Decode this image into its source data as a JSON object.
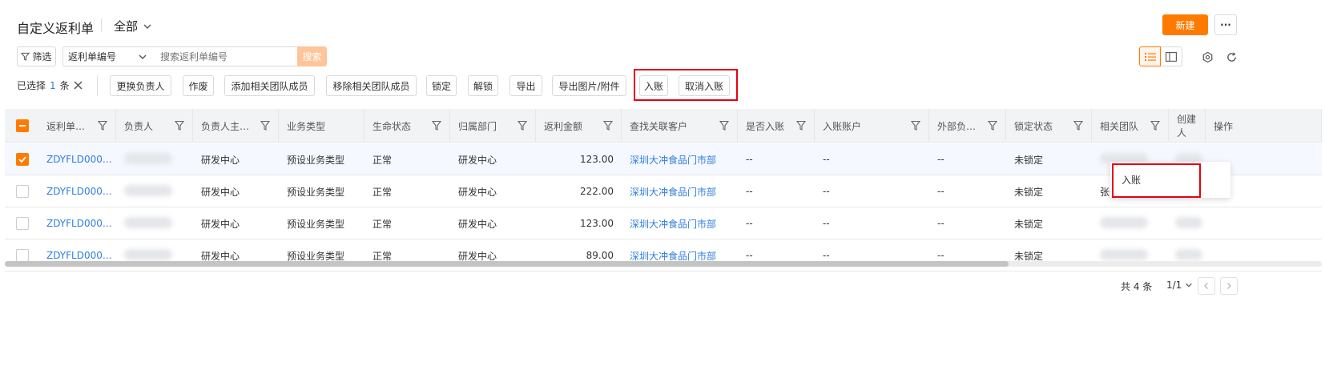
{
  "header": {
    "title": "自定义返利单",
    "view_label": "全部",
    "new_button": "新建",
    "more": "···"
  },
  "filterbar": {
    "filter_label": "筛选",
    "field_select": "返利单编号",
    "search_placeholder": "搜索返利单编号",
    "search_button": "搜索"
  },
  "selection": {
    "prefix": "已选择",
    "count": "1",
    "suffix": "条"
  },
  "actions": [
    "更换负责人",
    "作废",
    "添加相关团队成员",
    "移除相关团队成员",
    "锁定",
    "解锁",
    "导出",
    "导出图片/附件",
    "入账",
    "取消入账"
  ],
  "columns": [
    "返利单…",
    "负责人",
    "负责人主…",
    "业务类型",
    "生命状态",
    "归属部门",
    "返利金额",
    "查找关联客户",
    "是否入账",
    "入账账户",
    "外部负…",
    "锁定状态",
    "相关团队",
    "创建人",
    "操作"
  ],
  "rows": [
    {
      "id": "ZDYFLD000…",
      "owner_dept": "研发中心",
      "biz_type": "预设业务类型",
      "life": "正常",
      "dept": "研发中心",
      "amount": "123.00",
      "customer": "深圳大冲食品门市部",
      "posted": "--",
      "account": "--",
      "ext": "--",
      "lock": "未锁定",
      "team": ""
    },
    {
      "id": "ZDYFLD000…",
      "owner_dept": "研发中心",
      "biz_type": "预设业务类型",
      "life": "正常",
      "dept": "研发中心",
      "amount": "222.00",
      "customer": "深圳大冲食品门市部",
      "posted": "--",
      "account": "--",
      "ext": "--",
      "lock": "未锁定",
      "team": "张"
    },
    {
      "id": "ZDYFLD000…",
      "owner_dept": "研发中心",
      "biz_type": "预设业务类型",
      "life": "正常",
      "dept": "研发中心",
      "amount": "123.00",
      "customer": "深圳大冲食品门市部",
      "posted": "--",
      "account": "--",
      "ext": "--",
      "lock": "未锁定",
      "team": ""
    },
    {
      "id": "ZDYFLD000…",
      "owner_dept": "研发中心",
      "biz_type": "预设业务类型",
      "life": "正常",
      "dept": "研发中心",
      "amount": "89.00",
      "customer": "深圳大冲食品门市部",
      "posted": "--",
      "account": "--",
      "ext": "--",
      "lock": "未锁定",
      "team": ""
    }
  ],
  "popup": {
    "item": "入账"
  },
  "pagination": {
    "total": "共 4 条",
    "page": "1/1"
  },
  "colors": {
    "accent": "#ff7a00",
    "link": "#2f7ee0",
    "highlight": "#e60012"
  }
}
